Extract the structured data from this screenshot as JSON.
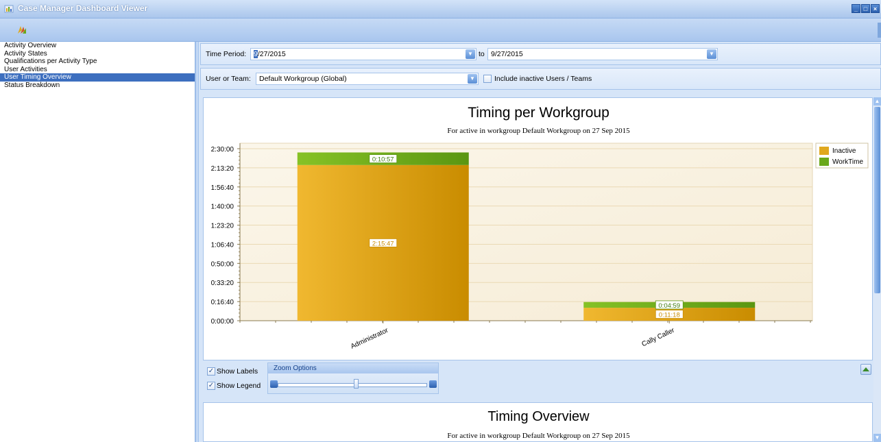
{
  "window": {
    "title": "Case Manager Dashboard Viewer",
    "buttons": [
      "_",
      "□",
      "×"
    ]
  },
  "toolbar": {
    "icon": "dashboard-icon"
  },
  "nav": {
    "items": [
      {
        "label": "Activity Overview",
        "selected": false
      },
      {
        "label": "Activity States",
        "selected": false
      },
      {
        "label": "Qualifications per Activity Type",
        "selected": false
      },
      {
        "label": "User Activities",
        "selected": false
      },
      {
        "label": "User Timing Overview",
        "selected": true
      },
      {
        "label": "Status Breakdown",
        "selected": false
      }
    ]
  },
  "filters": {
    "time_period_label": "Time Period:",
    "from_date_first": "9",
    "from_date_rest": "/27/2015",
    "to_label": "to",
    "to_date": "9/27/2015",
    "user_team_label": "User or Team:",
    "user_team_value": "Default Workgroup (Global)",
    "include_inactive_label": "Include inactive Users / Teams",
    "include_inactive_checked": false
  },
  "chart_data": {
    "type": "bar",
    "stacked": true,
    "title": "Timing per Workgroup",
    "subtitle": "For active in workgroup Default Workgroup on 27 Sep 2015",
    "categories": [
      "Administrator",
      "Cally Caller"
    ],
    "series": [
      {
        "name": "Inactive",
        "color": "#e0a81e",
        "values": [
          8147,
          678
        ],
        "labels": [
          "2:15:47",
          "0:11:18"
        ]
      },
      {
        "name": "WorkTime",
        "color": "#6aa81a",
        "values": [
          657,
          299
        ],
        "labels": [
          "0:10:57",
          "0:04:59"
        ]
      }
    ],
    "ylim": [
      0,
      9000
    ],
    "yticks": [
      0,
      1000,
      2000,
      3000,
      4000,
      5000,
      6000,
      7000,
      8000,
      9000
    ],
    "ytick_labels": [
      "0:00:00",
      "0:16:40",
      "0:33:20",
      "0:50:00",
      "1:06:40",
      "1:23:20",
      "1:40:00",
      "1:56:40",
      "2:13:20",
      "2:30:00"
    ],
    "legend_position": "top-right",
    "grid": true
  },
  "controls": {
    "show_labels": "Show Labels",
    "show_legend": "Show Legend",
    "zoom_options": "Zoom Options",
    "zoom_level": 0.53
  },
  "second_panel": {
    "title": "Timing Overview",
    "subtitle": "For active in workgroup Default Workgroup on 27 Sep 2015"
  }
}
